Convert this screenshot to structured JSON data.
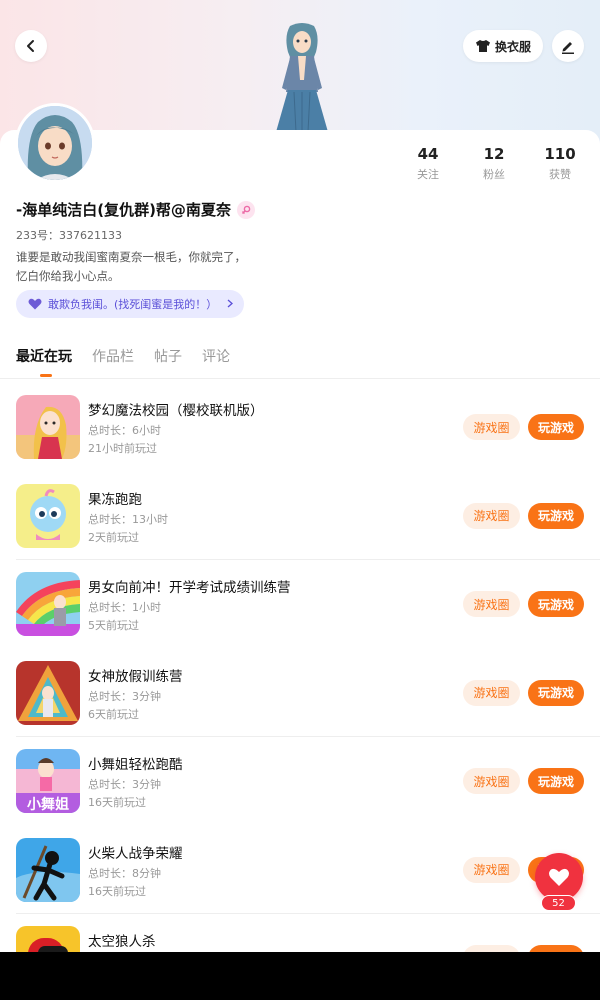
{
  "header": {
    "outfit_label": "换衣服"
  },
  "profile": {
    "username": "-海单纯洁白(复仇群)帮@南夏奈",
    "uid": "233号：337621133",
    "bio_line1": "谁要是敢动我闺蜜南夏奈一根毛，你就完了，",
    "bio_line2": "忆白你给我小心点。",
    "bestie_label": "敢欺负我闺。(找死闺蜜是我的！）",
    "stats": [
      {
        "value": "44",
        "label": "关注"
      },
      {
        "value": "12",
        "label": "粉丝"
      },
      {
        "value": "110",
        "label": "获赞"
      }
    ]
  },
  "tabs": [
    {
      "label": "最近在玩"
    },
    {
      "label": "作品栏"
    },
    {
      "label": "帖子"
    },
    {
      "label": "评论"
    }
  ],
  "buttons": {
    "circle_label": "游戏圈",
    "play_label": "玩游戏"
  },
  "games": [
    {
      "name": "梦幻魔法校园（樱校联机版）",
      "time": "总时长：6小时",
      "ago": "21小时前玩过",
      "icon": "magic-school-icon"
    },
    {
      "name": "果冻跑跑",
      "time": "总时长：13小时",
      "ago": "2天前玩过",
      "icon": "jelly-run-icon"
    },
    {
      "name": "男女向前冲！开学考试成绩训练营",
      "time": "总时长：1小时",
      "ago": "5天前玩过",
      "icon": "rainbow-run-icon"
    },
    {
      "name": "女神放假训练营",
      "time": "总时长：3分钟",
      "ago": "6天前玩过",
      "icon": "goddess-camp-icon"
    },
    {
      "name": "小舞姐轻松跑酷",
      "time": "总时长：3分钟",
      "ago": "16天前玩过",
      "icon": "dance-parkour-icon",
      "icon_text": "小舞姐"
    },
    {
      "name": "火柴人战争荣耀",
      "time": "总时长：8分钟",
      "ago": "16天前玩过",
      "icon": "stickman-war-icon"
    },
    {
      "name": "太空狼人杀",
      "time": "",
      "ago": "",
      "icon": "space-werewolf-icon"
    }
  ],
  "like": {
    "count": "52"
  },
  "colors": {
    "accent": "#f97316",
    "like": "#f0323f",
    "bestie_bg": "#e9eaff",
    "bestie_text": "#5a4fd8"
  }
}
